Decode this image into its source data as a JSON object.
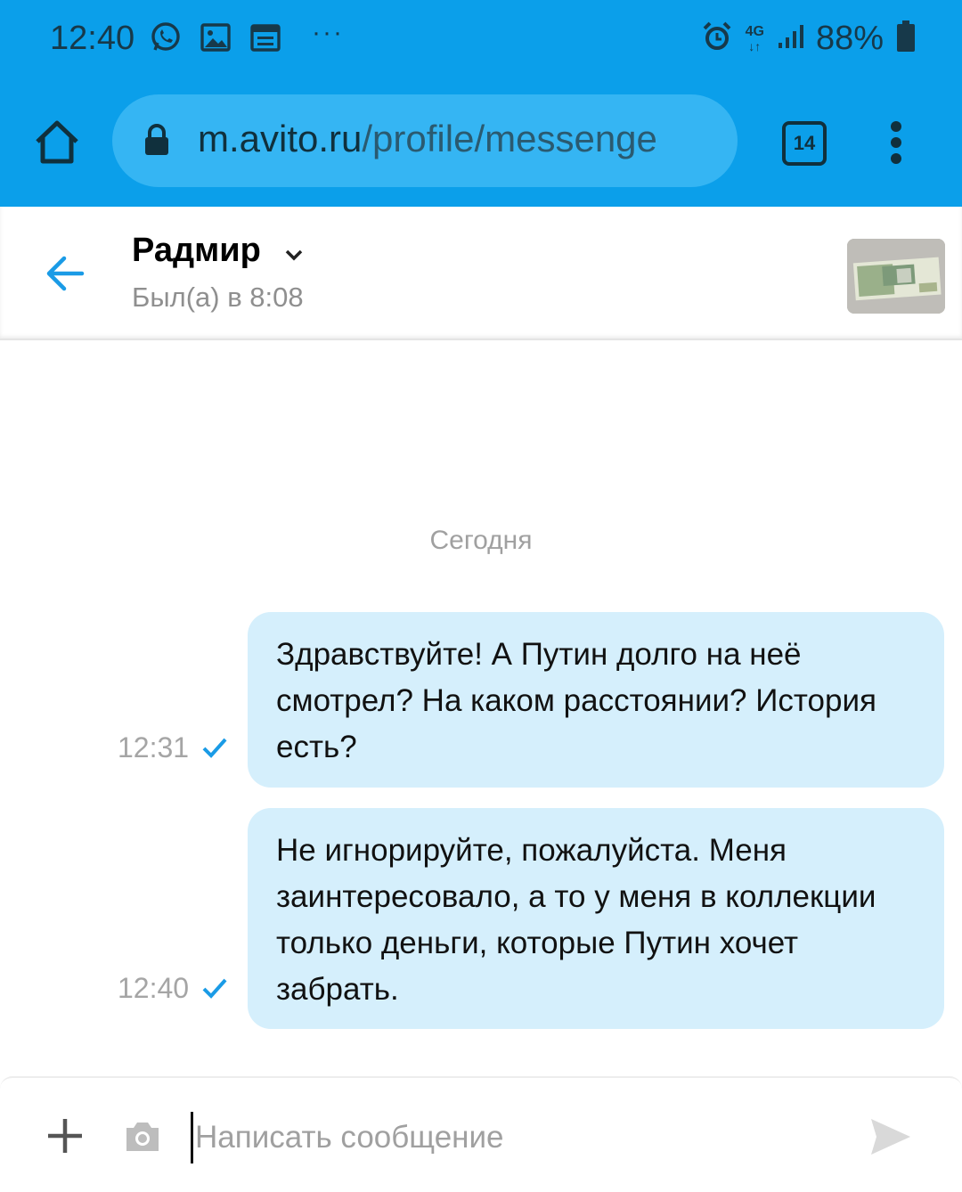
{
  "status_bar": {
    "time": "12:40",
    "network": "4G",
    "battery": "88%",
    "notification_icons": [
      "whatsapp-icon",
      "image-icon",
      "calendar-icon",
      "more-dots-icon"
    ]
  },
  "browser": {
    "url_host": "m.avito.ru",
    "url_path": "/profile/messenge",
    "tab_count": "14",
    "bar_color": "#0b9fea"
  },
  "chat": {
    "contact_name": "Радмир",
    "last_seen": "Был(а) в 8:08",
    "date_separator": "Сегодня",
    "messages": [
      {
        "text": "Здравствуйте! А Путин долго на неё смотрел? На каком расстоянии? История есть?",
        "time": "12:31",
        "status": "sent"
      },
      {
        "text": "Не игнорируйте, пожалуйста. Меня заинтересовало, а то у меня в коллекции только деньги, которые Путин хочет забрать.",
        "time": "12:40",
        "status": "sent"
      }
    ]
  },
  "composer": {
    "placeholder": "Написать сообщение"
  },
  "colors": {
    "accent": "#0b9fea",
    "bubble": "#d5effc",
    "check": "#1a9be6"
  }
}
